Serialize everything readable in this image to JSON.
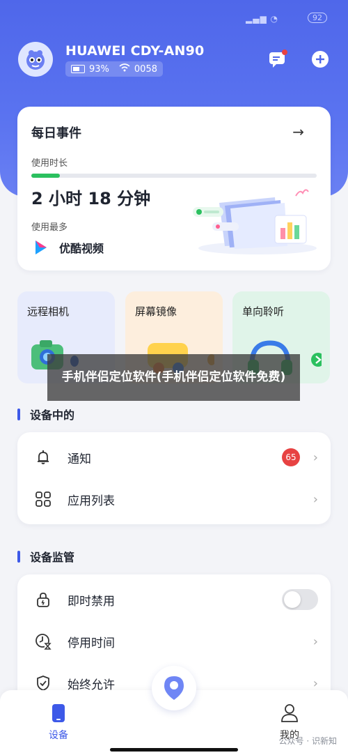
{
  "status_bar": {
    "signal": "",
    "battery": "92"
  },
  "device": {
    "name": "HUAWEI CDY-AN90",
    "battery": "93%",
    "wifi_id": "0058"
  },
  "daily": {
    "title": "每日事件",
    "usage_label": "使用时长",
    "duration": "2 小时 18 分钟",
    "usage_fraction": 0.1,
    "most_used_label": "使用最多",
    "most_used_app": "优酷视频"
  },
  "features": [
    {
      "label": "远程相机"
    },
    {
      "label": "屏幕镜像"
    },
    {
      "label": "单向聆听"
    }
  ],
  "overlay": {
    "text": "手机伴侣定位软件(手机伴侣定位软件免费)"
  },
  "section_in_device": {
    "title": "设备中的",
    "items": [
      {
        "label": "通知",
        "badge": "65"
      },
      {
        "label": "应用列表"
      }
    ]
  },
  "section_control": {
    "title": "设备监管",
    "items": [
      {
        "label": "即时禁用",
        "toggle": false
      },
      {
        "label": "停用时间"
      },
      {
        "label": "始终允许"
      }
    ]
  },
  "tabs": [
    {
      "label": "设备"
    },
    {
      "label": "我的"
    }
  ],
  "footer": {
    "watermark": "公众号 · 识新知"
  },
  "colors": {
    "primary": "#4f67ea",
    "badge": "#e74242",
    "progress": "#2bc05f"
  }
}
